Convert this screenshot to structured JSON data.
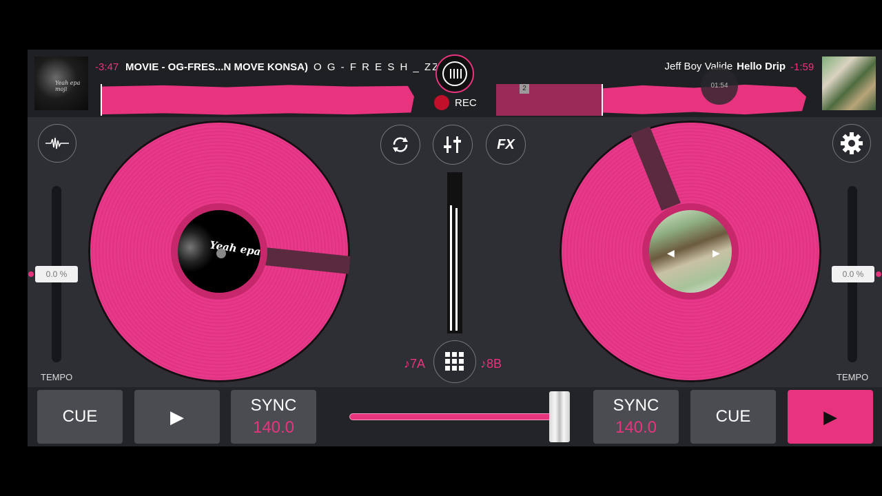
{
  "colors": {
    "accent": "#e8347f",
    "background": "#2e2f34",
    "topbar": "#1f2024"
  },
  "deck_a": {
    "time_remaining": "-3:47",
    "title": "MOVIE - OG-FRES...N MOVE KONSA)",
    "artist": "O G - F R E S H _ ZZ🎸",
    "cover_text": "Yeah epa moji",
    "label_text": "Yeah epa m",
    "tempo_value": "0.0 %",
    "tempo_label": "TEMPO",
    "key": "♪7A",
    "cue_label": "CUE",
    "sync_label": "SYNC",
    "bpm": "140.0",
    "playing": false
  },
  "deck_b": {
    "time_remaining": "-1:59",
    "artist": "Jeff Boy Valide",
    "title": "Hello Drip",
    "position_time": "01:54",
    "cue_marker": "2",
    "tempo_value": "0.0 %",
    "tempo_label": "TEMPO",
    "key": "♪8B",
    "cue_label": "CUE",
    "sync_label": "SYNC",
    "bpm": "140.0",
    "playing": true
  },
  "recorder": {
    "label": "REC"
  },
  "mixer": {
    "fx_label": "FX",
    "crossfader_position": 0.98
  },
  "icons": [
    "waveform-icon",
    "loop-icon",
    "mixer-sliders-icon",
    "fx-icon",
    "settings-gear-icon",
    "pads-grid-icon",
    "record-icon",
    "play-icon"
  ]
}
